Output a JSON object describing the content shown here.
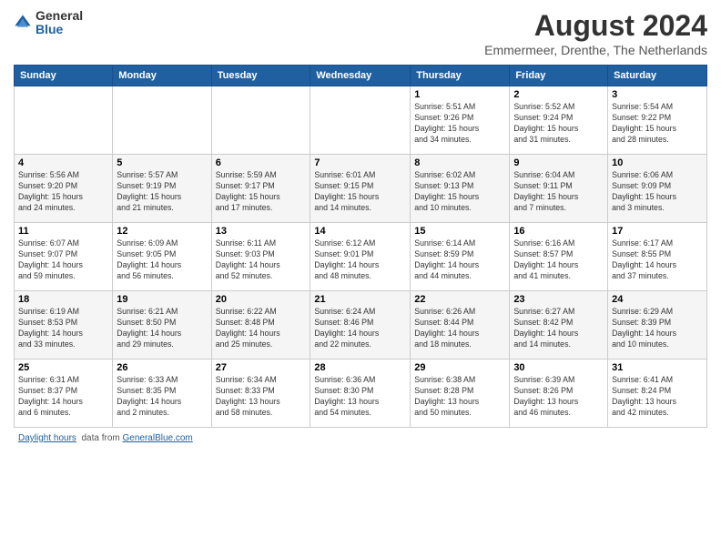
{
  "logo": {
    "general": "General",
    "blue": "Blue"
  },
  "header": {
    "title": "August 2024",
    "subtitle": "Emmermeer, Drenthe, The Netherlands"
  },
  "days_of_week": [
    "Sunday",
    "Monday",
    "Tuesday",
    "Wednesday",
    "Thursday",
    "Friday",
    "Saturday"
  ],
  "weeks": [
    [
      {
        "day": "",
        "info": ""
      },
      {
        "day": "",
        "info": ""
      },
      {
        "day": "",
        "info": ""
      },
      {
        "day": "",
        "info": ""
      },
      {
        "day": "1",
        "info": "Sunrise: 5:51 AM\nSunset: 9:26 PM\nDaylight: 15 hours\nand 34 minutes."
      },
      {
        "day": "2",
        "info": "Sunrise: 5:52 AM\nSunset: 9:24 PM\nDaylight: 15 hours\nand 31 minutes."
      },
      {
        "day": "3",
        "info": "Sunrise: 5:54 AM\nSunset: 9:22 PM\nDaylight: 15 hours\nand 28 minutes."
      }
    ],
    [
      {
        "day": "4",
        "info": "Sunrise: 5:56 AM\nSunset: 9:20 PM\nDaylight: 15 hours\nand 24 minutes."
      },
      {
        "day": "5",
        "info": "Sunrise: 5:57 AM\nSunset: 9:19 PM\nDaylight: 15 hours\nand 21 minutes."
      },
      {
        "day": "6",
        "info": "Sunrise: 5:59 AM\nSunset: 9:17 PM\nDaylight: 15 hours\nand 17 minutes."
      },
      {
        "day": "7",
        "info": "Sunrise: 6:01 AM\nSunset: 9:15 PM\nDaylight: 15 hours\nand 14 minutes."
      },
      {
        "day": "8",
        "info": "Sunrise: 6:02 AM\nSunset: 9:13 PM\nDaylight: 15 hours\nand 10 minutes."
      },
      {
        "day": "9",
        "info": "Sunrise: 6:04 AM\nSunset: 9:11 PM\nDaylight: 15 hours\nand 7 minutes."
      },
      {
        "day": "10",
        "info": "Sunrise: 6:06 AM\nSunset: 9:09 PM\nDaylight: 15 hours\nand 3 minutes."
      }
    ],
    [
      {
        "day": "11",
        "info": "Sunrise: 6:07 AM\nSunset: 9:07 PM\nDaylight: 14 hours\nand 59 minutes."
      },
      {
        "day": "12",
        "info": "Sunrise: 6:09 AM\nSunset: 9:05 PM\nDaylight: 14 hours\nand 56 minutes."
      },
      {
        "day": "13",
        "info": "Sunrise: 6:11 AM\nSunset: 9:03 PM\nDaylight: 14 hours\nand 52 minutes."
      },
      {
        "day": "14",
        "info": "Sunrise: 6:12 AM\nSunset: 9:01 PM\nDaylight: 14 hours\nand 48 minutes."
      },
      {
        "day": "15",
        "info": "Sunrise: 6:14 AM\nSunset: 8:59 PM\nDaylight: 14 hours\nand 44 minutes."
      },
      {
        "day": "16",
        "info": "Sunrise: 6:16 AM\nSunset: 8:57 PM\nDaylight: 14 hours\nand 41 minutes."
      },
      {
        "day": "17",
        "info": "Sunrise: 6:17 AM\nSunset: 8:55 PM\nDaylight: 14 hours\nand 37 minutes."
      }
    ],
    [
      {
        "day": "18",
        "info": "Sunrise: 6:19 AM\nSunset: 8:53 PM\nDaylight: 14 hours\nand 33 minutes."
      },
      {
        "day": "19",
        "info": "Sunrise: 6:21 AM\nSunset: 8:50 PM\nDaylight: 14 hours\nand 29 minutes."
      },
      {
        "day": "20",
        "info": "Sunrise: 6:22 AM\nSunset: 8:48 PM\nDaylight: 14 hours\nand 25 minutes."
      },
      {
        "day": "21",
        "info": "Sunrise: 6:24 AM\nSunset: 8:46 PM\nDaylight: 14 hours\nand 22 minutes."
      },
      {
        "day": "22",
        "info": "Sunrise: 6:26 AM\nSunset: 8:44 PM\nDaylight: 14 hours\nand 18 minutes."
      },
      {
        "day": "23",
        "info": "Sunrise: 6:27 AM\nSunset: 8:42 PM\nDaylight: 14 hours\nand 14 minutes."
      },
      {
        "day": "24",
        "info": "Sunrise: 6:29 AM\nSunset: 8:39 PM\nDaylight: 14 hours\nand 10 minutes."
      }
    ],
    [
      {
        "day": "25",
        "info": "Sunrise: 6:31 AM\nSunset: 8:37 PM\nDaylight: 14 hours\nand 6 minutes."
      },
      {
        "day": "26",
        "info": "Sunrise: 6:33 AM\nSunset: 8:35 PM\nDaylight: 14 hours\nand 2 minutes."
      },
      {
        "day": "27",
        "info": "Sunrise: 6:34 AM\nSunset: 8:33 PM\nDaylight: 13 hours\nand 58 minutes."
      },
      {
        "day": "28",
        "info": "Sunrise: 6:36 AM\nSunset: 8:30 PM\nDaylight: 13 hours\nand 54 minutes."
      },
      {
        "day": "29",
        "info": "Sunrise: 6:38 AM\nSunset: 8:28 PM\nDaylight: 13 hours\nand 50 minutes."
      },
      {
        "day": "30",
        "info": "Sunrise: 6:39 AM\nSunset: 8:26 PM\nDaylight: 13 hours\nand 46 minutes."
      },
      {
        "day": "31",
        "info": "Sunrise: 6:41 AM\nSunset: 8:24 PM\nDaylight: 13 hours\nand 42 minutes."
      }
    ]
  ],
  "footer": {
    "text": "Daylight hours",
    "link_text": "GeneralBlue.com"
  }
}
